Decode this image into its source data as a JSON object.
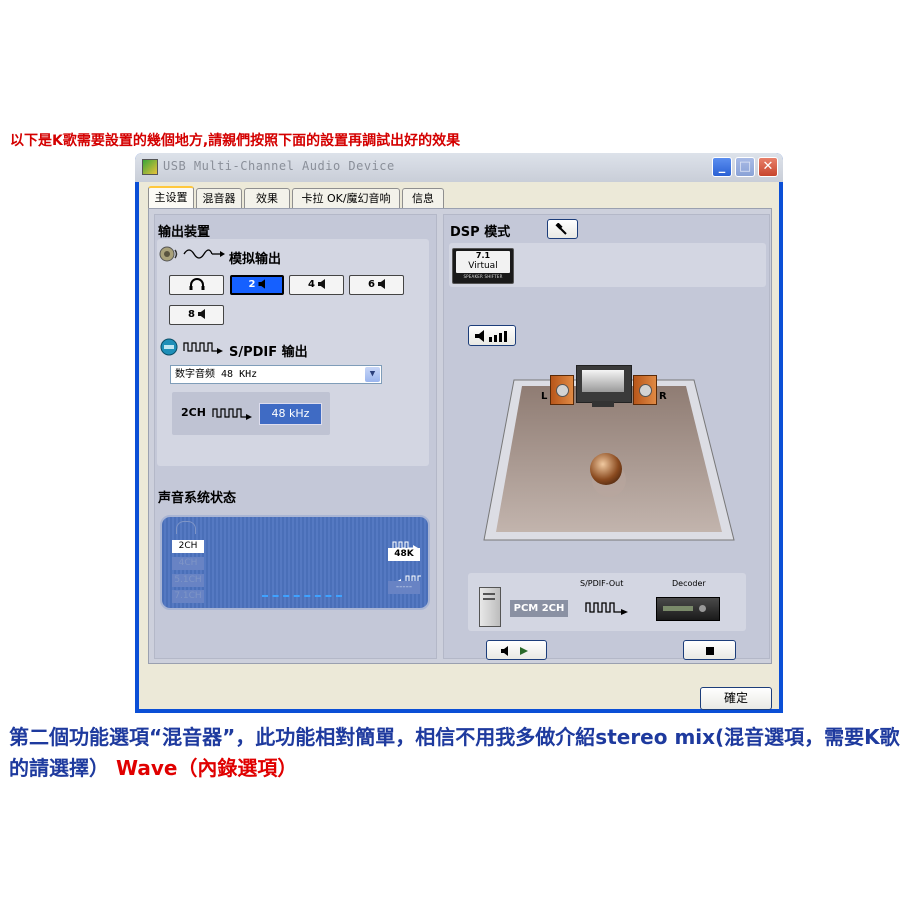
{
  "captions": {
    "top": "以下是K歌需要設置的幾個地方,請親們按照下面的設置再調試出好的效果",
    "bottom_part1": "第二個功能選項“混音器”，此功能相對簡單，相信不用我多做介紹stereo mix(混音選項，需要K歌的請選擇）",
    "bottom_part2": "Wave（內錄選項）"
  },
  "window": {
    "title": "USB Multi-Channel Audio Device",
    "minimize": "_",
    "maximize": "□",
    "close": "✕"
  },
  "tabs": [
    "主设置",
    "混音器",
    "效果",
    "卡拉 OK/魔幻音响",
    "信息"
  ],
  "output": {
    "section_title": "输出装置",
    "analog_title": "模拟输出",
    "speaker_buttons": [
      "2",
      "4",
      "6",
      "8"
    ],
    "selected": "2",
    "spdif_title": "S/PDIF 输出",
    "spdif_select_value": "数字音频 48 KHz",
    "spdif_chain_label": "2CH",
    "spdif_rate": "48 kHz"
  },
  "status": {
    "section_title": "声音系统状态",
    "channels": [
      "2CH",
      "4CH",
      "5.1CH",
      "7.1CH"
    ],
    "active_channel": "2CH",
    "rate_out": "48K",
    "rate_in": "-----"
  },
  "dsp": {
    "title": "DSP 模式",
    "virtual_top": "7.1",
    "virtual_mid": "Virtual",
    "virtual_bottom": "SPEAKER SHIFTER",
    "left_label": "L",
    "right_label": "R",
    "spdif_out_label": "S/PDIF-Out",
    "decoder_label": "Decoder",
    "pcm_label": "PCM 2CH"
  },
  "ok_button": "確定",
  "colors": {
    "title_bar_blue": "#0b4fd6",
    "active_speaker": "#1560ff",
    "caption_blue": "#1e3a9e",
    "caption_red": "#e00000"
  }
}
